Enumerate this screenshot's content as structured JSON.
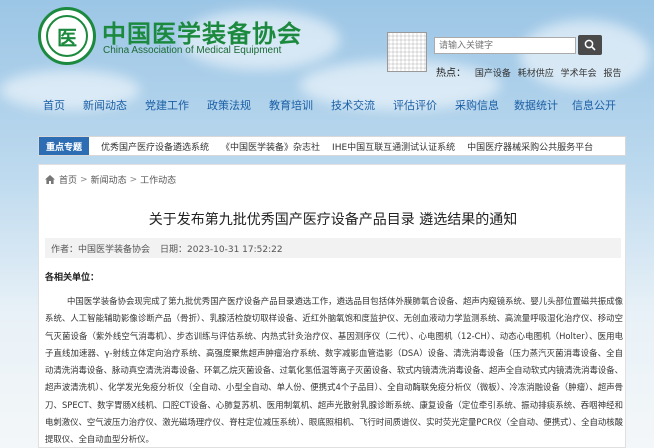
{
  "header": {
    "title_cn": "中国医学装备协会",
    "title_en": "China Association of Medical Equipment",
    "logo_glyph": "医"
  },
  "search": {
    "placeholder": "请输入关键字"
  },
  "hot": {
    "label": "热点：",
    "items": [
      "国产设备",
      "耗材供应",
      "学术年会",
      "报告"
    ]
  },
  "nav": {
    "items": [
      "首页",
      "新闻动态",
      "党建工作",
      "政策法规",
      "教育培训",
      "技术交流",
      "评估评价",
      "采购信息",
      "数据统计",
      "信息公开"
    ]
  },
  "topics": {
    "label": "重点专题",
    "items": [
      "优秀国产医疗设备遴选系统",
      "《中国医学装备》杂志社",
      "IHE中国互联互通测试认证系统",
      "中国医疗器械采购公共服务平台"
    ]
  },
  "breadcrumb": [
    "首页",
    "新闻动态",
    "工作动态"
  ],
  "article": {
    "title": "关于发布第九批优秀国产医疗设备产品目录 遴选结果的通知",
    "author": "作者：中国医学装备协会",
    "date": "日期：2023-10-31 17:52:22",
    "salutation": "各相关单位：",
    "body": "中国医学装备协会现完成了第九批优秀国产医疗设备产品目录遴选工作，遴选品目包括体外膜肺氧合设备、超声内窥镜系统、婴儿头部位置磁共振成像系统、人工智能辅助影像诊断产品（骨折）、乳腺活检旋切取样设备、近红外脑氧饱和度监护仪、无创血液动力学监测系统、高流量呼吸湿化治疗仪、移动空气灭菌设备（紫外线空气消毒机）、步态训练与评估系统、内热式针灸治疗仪、基因测序仪（二代）、心电图机（12-CH）、动态心电图机（Holter）、医用电子直线加速器、γ-射线立体定向治疗系统、高强度聚焦超声肿瘤治疗系统、数字减影血管造影（DSA）设备、清洗消毒设备（压力蒸汽灭菌消毒设备、全自动清洗消毒设备、脉动真空清洗消毒设备、环氧乙烷灭菌设备、过氧化氢低温等离子灭菌设备、软式内镜清洗消毒设备、超声全自动软式内镜清洗消毒设备、超声波清洗机）、化学发光免疫分析仪（全自动、小型全自动、单人份、便携式4个子品目）、全自动酶联免疫分析仪（微板）、冷冻消融设备（肿瘤）、超声骨刀、SPECT、数字胃肠X线机、口腔CT设备、心肺复苏机、医用制氧机、超声光散射乳腺诊断系统、康复设备（定位牵引系统、振动排痰系统、吞咽神经和电刺激仪、空气波压力治疗仪、激光磁场理疗仪、脊柱定位减压系统）、眼底照相机、飞行时间质谱仪、实时荧光定量PCR仪（全自动、便携式）、全自动核酸提取仪、全自动血型分析仪。"
  },
  "colors": {
    "brand_green": "#1c8a3e",
    "nav_blue": "#1b5fa6",
    "topic_blue": "#2c6db3"
  }
}
